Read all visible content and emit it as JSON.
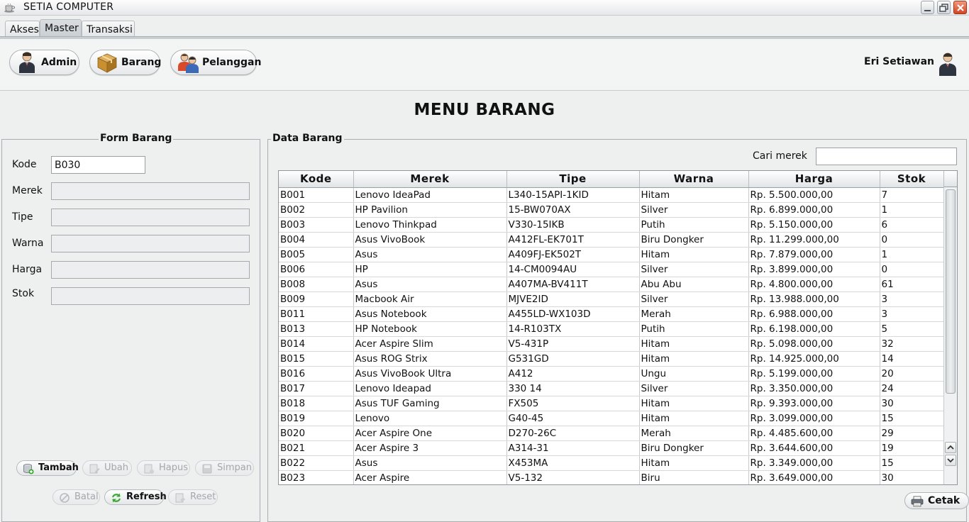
{
  "window": {
    "title": "SETIA COMPUTER"
  },
  "tabs": [
    {
      "label": "Akses"
    },
    {
      "label": "Master"
    },
    {
      "label": "Transaksi"
    }
  ],
  "nav": {
    "admin_label": "Admin",
    "barang_label": "Barang",
    "pelanggan_label": "Pelanggan",
    "user_name": "Eri Setiawan"
  },
  "page_title": "MENU BARANG",
  "form": {
    "title": "Form Barang",
    "kode_label": "Kode",
    "kode_value": "B030",
    "merek_label": "Merek",
    "merek_value": "",
    "tipe_label": "Tipe",
    "tipe_value": "",
    "warna_label": "Warna",
    "warna_value": "",
    "harga_label": "Harga",
    "harga_value": "",
    "stok_label": "Stok",
    "stok_value": "",
    "buttons": {
      "tambah": "Tambah",
      "ubah": "Ubah",
      "hapus": "Hapus",
      "simpan": "Simpan",
      "batal": "Batal",
      "refresh": "Refresh",
      "reset": "Reset"
    }
  },
  "data": {
    "title": "Data Barang",
    "search_label": "Cari merek",
    "search_value": "",
    "columns": [
      "Kode",
      "Merek",
      "Tipe",
      "Warna",
      "Harga",
      "Stok"
    ],
    "rows": [
      [
        "B001",
        "Lenovo IdeaPad",
        "L340-15API-1KID",
        "Hitam",
        "Rp. 5.500.000,00",
        "7"
      ],
      [
        "B002",
        "HP Pavilion",
        "15-BW070AX",
        "Silver",
        "Rp. 6.899.000,00",
        "1"
      ],
      [
        "B003",
        "Lenovo Thinkpad",
        "V330-15IKB",
        "Putih",
        "Rp. 5.150.000,00",
        "6"
      ],
      [
        "B004",
        "Asus VivoBook",
        "A412FL-EK701T",
        "Biru Dongker",
        "Rp. 11.299.000,00",
        "0"
      ],
      [
        "B005",
        "Asus",
        "A409FJ-EK502T",
        "Hitam",
        "Rp. 7.879.000,00",
        "1"
      ],
      [
        "B006",
        "HP",
        "14-CM0094AU",
        "Silver",
        "Rp. 3.899.000,00",
        "0"
      ],
      [
        "B008",
        "Asus",
        "A407MA-BV411T",
        "Abu Abu",
        "Rp. 4.800.000,00",
        "61"
      ],
      [
        "B009",
        "Macbook Air",
        "MJVE2ID",
        "Silver",
        "Rp. 13.988.000,00",
        "3"
      ],
      [
        "B011",
        "Asus Notebook",
        "A455LD-WX103D",
        "Merah",
        "Rp. 6.988.000,00",
        "3"
      ],
      [
        "B013",
        "HP Notebook",
        "14-R103TX",
        "Putih",
        "Rp. 6.198.000,00",
        "5"
      ],
      [
        "B014",
        "Acer Aspire Slim",
        "V5-431P",
        "Hitam",
        "Rp. 5.098.000,00",
        "32"
      ],
      [
        "B015",
        "Asus ROG Strix",
        "G531GD",
        "Hitam",
        "Rp. 14.925.000,00",
        "14"
      ],
      [
        "B016",
        "Asus VivoBook Ultra",
        "A412",
        "Ungu",
        "Rp. 5.199.000,00",
        "20"
      ],
      [
        "B017",
        "Lenovo Ideapad",
        "330 14",
        "Silver",
        "Rp. 3.350.000,00",
        "24"
      ],
      [
        "B018",
        "Asus TUF Gaming",
        "FX505",
        "Hitam",
        "Rp. 9.393.000,00",
        "30"
      ],
      [
        "B019",
        "Lenovo",
        "G40-45",
        "Hitam",
        "Rp. 3.099.000,00",
        "15"
      ],
      [
        "B020",
        "Acer Aspire One",
        "D270-26C",
        "Merah",
        "Rp. 4.485.600,00",
        "29"
      ],
      [
        "B021",
        "Acer Aspire 3",
        "A314-31",
        "Biru Dongker",
        "Rp. 3.644.600,00",
        "19"
      ],
      [
        "B022",
        "Asus",
        "X453MA",
        "Hitam",
        "Rp. 3.349.000,00",
        "15"
      ],
      [
        "B023",
        "Acer Aspire",
        "V5-132",
        "Biru",
        "Rp. 3.649.000,00",
        "30"
      ]
    ],
    "print_label": "Cetak"
  },
  "icons": {
    "app": "coffee-cup-icon",
    "admin": "user-icon",
    "barang": "box-icon",
    "pelanggan": "users-icon",
    "avatar": "user-icon"
  },
  "colors": {
    "background": "#eef0f0",
    "close_button": "#d24520"
  }
}
